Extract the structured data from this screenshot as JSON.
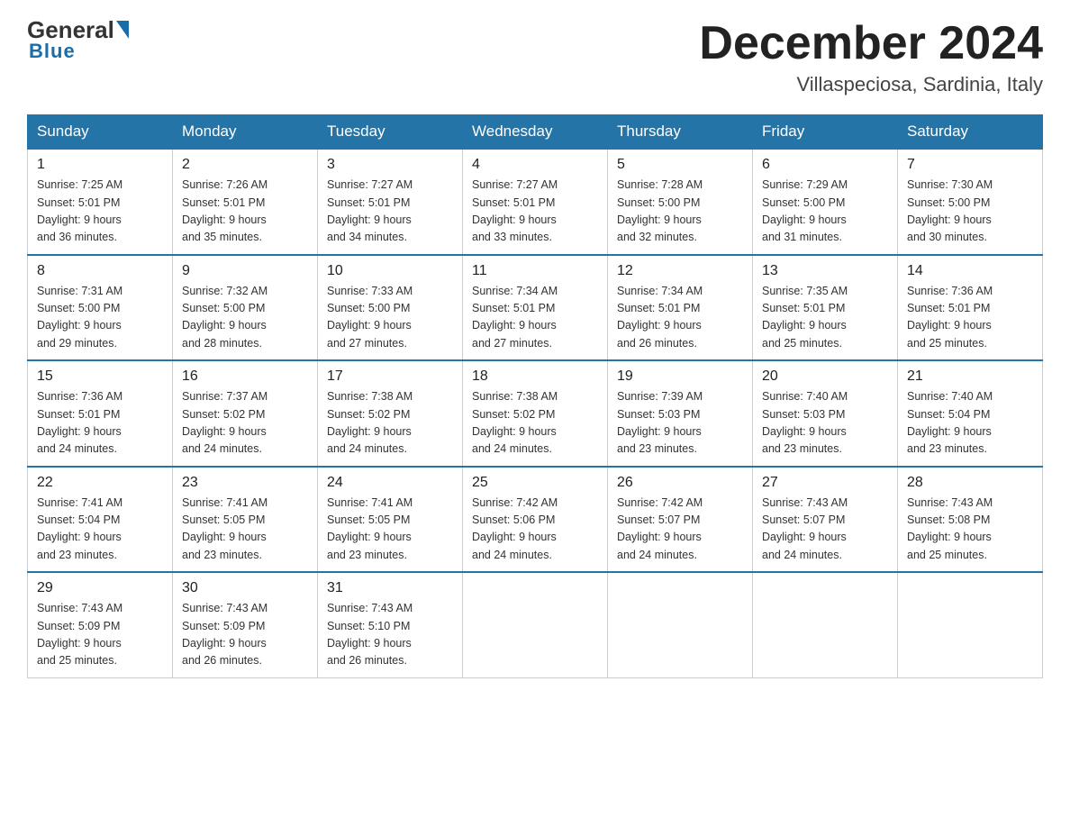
{
  "logo": {
    "general": "General",
    "blue": "Blue"
  },
  "title": "December 2024",
  "subtitle": "Villaspeciosa, Sardinia, Italy",
  "days_of_week": [
    "Sunday",
    "Monday",
    "Tuesday",
    "Wednesday",
    "Thursday",
    "Friday",
    "Saturday"
  ],
  "weeks": [
    [
      {
        "num": "1",
        "info": "Sunrise: 7:25 AM\nSunset: 5:01 PM\nDaylight: 9 hours\nand 36 minutes."
      },
      {
        "num": "2",
        "info": "Sunrise: 7:26 AM\nSunset: 5:01 PM\nDaylight: 9 hours\nand 35 minutes."
      },
      {
        "num": "3",
        "info": "Sunrise: 7:27 AM\nSunset: 5:01 PM\nDaylight: 9 hours\nand 34 minutes."
      },
      {
        "num": "4",
        "info": "Sunrise: 7:27 AM\nSunset: 5:01 PM\nDaylight: 9 hours\nand 33 minutes."
      },
      {
        "num": "5",
        "info": "Sunrise: 7:28 AM\nSunset: 5:00 PM\nDaylight: 9 hours\nand 32 minutes."
      },
      {
        "num": "6",
        "info": "Sunrise: 7:29 AM\nSunset: 5:00 PM\nDaylight: 9 hours\nand 31 minutes."
      },
      {
        "num": "7",
        "info": "Sunrise: 7:30 AM\nSunset: 5:00 PM\nDaylight: 9 hours\nand 30 minutes."
      }
    ],
    [
      {
        "num": "8",
        "info": "Sunrise: 7:31 AM\nSunset: 5:00 PM\nDaylight: 9 hours\nand 29 minutes."
      },
      {
        "num": "9",
        "info": "Sunrise: 7:32 AM\nSunset: 5:00 PM\nDaylight: 9 hours\nand 28 minutes."
      },
      {
        "num": "10",
        "info": "Sunrise: 7:33 AM\nSunset: 5:00 PM\nDaylight: 9 hours\nand 27 minutes."
      },
      {
        "num": "11",
        "info": "Sunrise: 7:34 AM\nSunset: 5:01 PM\nDaylight: 9 hours\nand 27 minutes."
      },
      {
        "num": "12",
        "info": "Sunrise: 7:34 AM\nSunset: 5:01 PM\nDaylight: 9 hours\nand 26 minutes."
      },
      {
        "num": "13",
        "info": "Sunrise: 7:35 AM\nSunset: 5:01 PM\nDaylight: 9 hours\nand 25 minutes."
      },
      {
        "num": "14",
        "info": "Sunrise: 7:36 AM\nSunset: 5:01 PM\nDaylight: 9 hours\nand 25 minutes."
      }
    ],
    [
      {
        "num": "15",
        "info": "Sunrise: 7:36 AM\nSunset: 5:01 PM\nDaylight: 9 hours\nand 24 minutes."
      },
      {
        "num": "16",
        "info": "Sunrise: 7:37 AM\nSunset: 5:02 PM\nDaylight: 9 hours\nand 24 minutes."
      },
      {
        "num": "17",
        "info": "Sunrise: 7:38 AM\nSunset: 5:02 PM\nDaylight: 9 hours\nand 24 minutes."
      },
      {
        "num": "18",
        "info": "Sunrise: 7:38 AM\nSunset: 5:02 PM\nDaylight: 9 hours\nand 24 minutes."
      },
      {
        "num": "19",
        "info": "Sunrise: 7:39 AM\nSunset: 5:03 PM\nDaylight: 9 hours\nand 23 minutes."
      },
      {
        "num": "20",
        "info": "Sunrise: 7:40 AM\nSunset: 5:03 PM\nDaylight: 9 hours\nand 23 minutes."
      },
      {
        "num": "21",
        "info": "Sunrise: 7:40 AM\nSunset: 5:04 PM\nDaylight: 9 hours\nand 23 minutes."
      }
    ],
    [
      {
        "num": "22",
        "info": "Sunrise: 7:41 AM\nSunset: 5:04 PM\nDaylight: 9 hours\nand 23 minutes."
      },
      {
        "num": "23",
        "info": "Sunrise: 7:41 AM\nSunset: 5:05 PM\nDaylight: 9 hours\nand 23 minutes."
      },
      {
        "num": "24",
        "info": "Sunrise: 7:41 AM\nSunset: 5:05 PM\nDaylight: 9 hours\nand 23 minutes."
      },
      {
        "num": "25",
        "info": "Sunrise: 7:42 AM\nSunset: 5:06 PM\nDaylight: 9 hours\nand 24 minutes."
      },
      {
        "num": "26",
        "info": "Sunrise: 7:42 AM\nSunset: 5:07 PM\nDaylight: 9 hours\nand 24 minutes."
      },
      {
        "num": "27",
        "info": "Sunrise: 7:43 AM\nSunset: 5:07 PM\nDaylight: 9 hours\nand 24 minutes."
      },
      {
        "num": "28",
        "info": "Sunrise: 7:43 AM\nSunset: 5:08 PM\nDaylight: 9 hours\nand 25 minutes."
      }
    ],
    [
      {
        "num": "29",
        "info": "Sunrise: 7:43 AM\nSunset: 5:09 PM\nDaylight: 9 hours\nand 25 minutes."
      },
      {
        "num": "30",
        "info": "Sunrise: 7:43 AM\nSunset: 5:09 PM\nDaylight: 9 hours\nand 26 minutes."
      },
      {
        "num": "31",
        "info": "Sunrise: 7:43 AM\nSunset: 5:10 PM\nDaylight: 9 hours\nand 26 minutes."
      },
      {
        "num": "",
        "info": ""
      },
      {
        "num": "",
        "info": ""
      },
      {
        "num": "",
        "info": ""
      },
      {
        "num": "",
        "info": ""
      }
    ]
  ]
}
